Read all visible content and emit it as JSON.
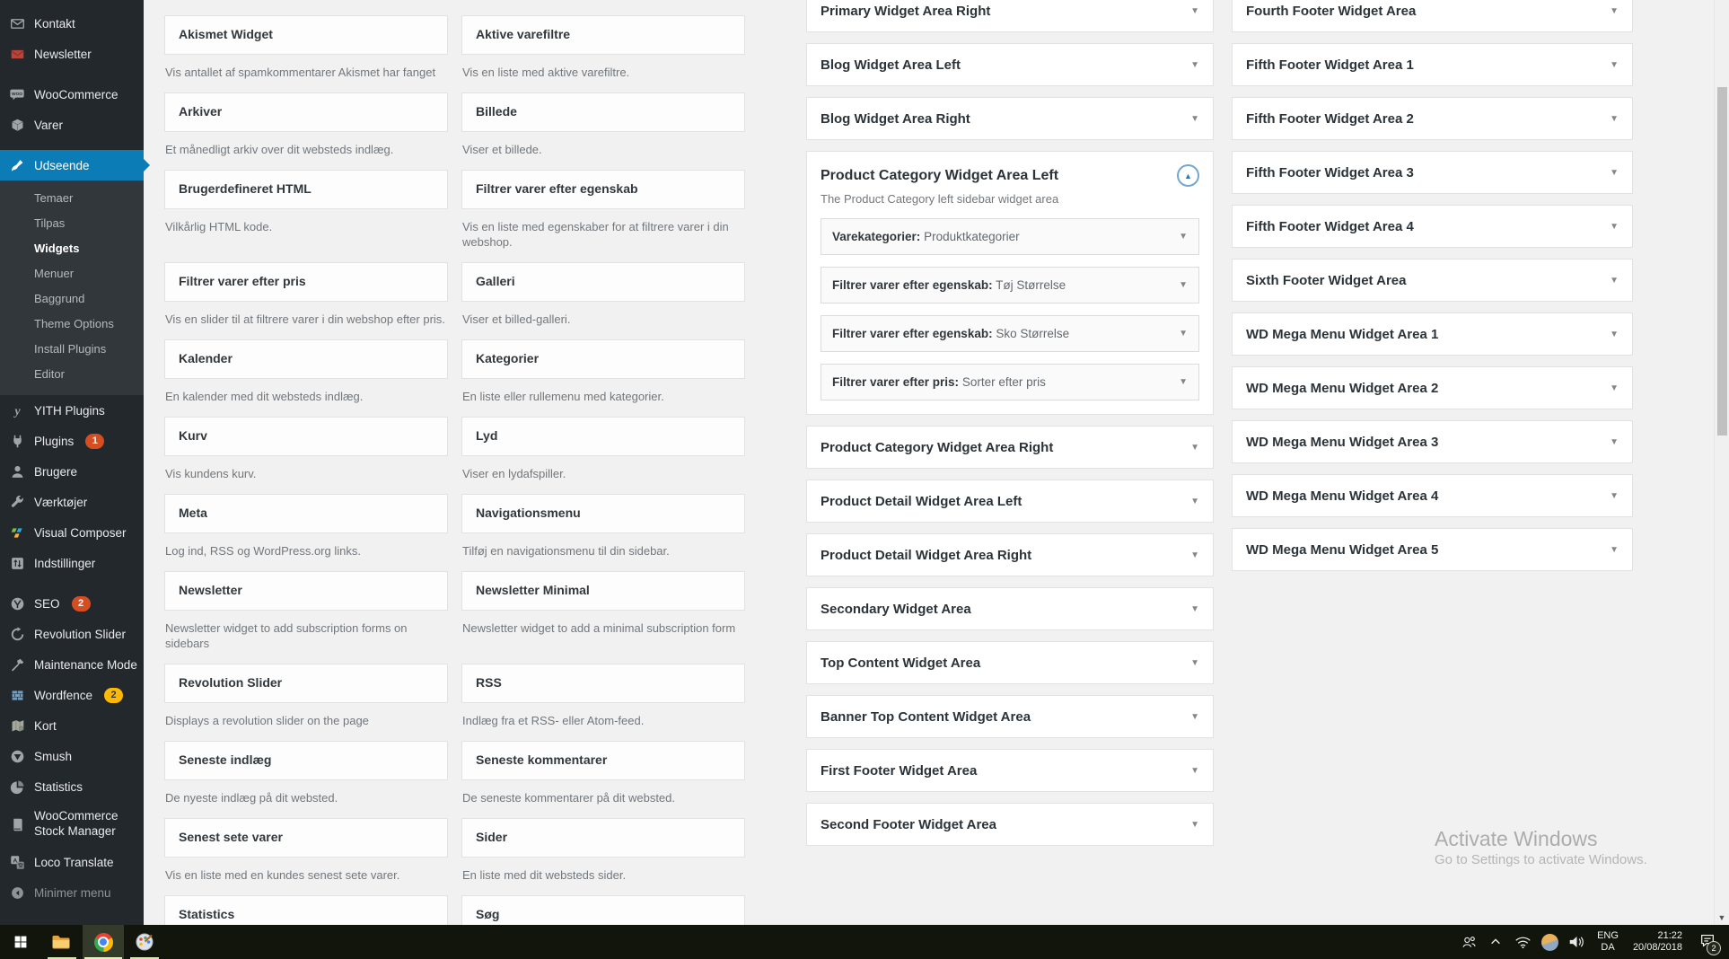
{
  "colors": {
    "accent_blue": "#0b7cb5",
    "badge_red": "#d54e21",
    "badge_yellow": "#ffb900",
    "sidebar_bg": "#23282d",
    "submenu_bg": "#32373c",
    "content_bg": "#f1f1f1"
  },
  "sidebar": {
    "items": [
      {
        "label": "Kontakt",
        "icon": "envelope-icon"
      },
      {
        "label": "Newsletter",
        "icon": "newsletter-envelope-icon"
      },
      {
        "sep": true
      },
      {
        "label": "WooCommerce",
        "icon": "woocommerce-icon"
      },
      {
        "label": "Varer",
        "icon": "product-box-icon"
      },
      {
        "sep": true
      },
      {
        "label": "Udseende",
        "icon": "paintbrush-icon",
        "active": true
      },
      {
        "submenu": [
          "Temaer",
          "Tilpas",
          "Widgets",
          "Menuer",
          "Baggrund",
          "Theme Options",
          "Install Plugins",
          "Editor"
        ],
        "current": "Widgets"
      },
      {
        "label": "YITH Plugins",
        "icon": "yith-icon"
      },
      {
        "label": "Plugins",
        "icon": "plug-icon",
        "badge": "1",
        "badge_style": "red"
      },
      {
        "label": "Brugere",
        "icon": "user-icon"
      },
      {
        "label": "Værktøjer",
        "icon": "wrench-icon"
      },
      {
        "label": "Visual Composer",
        "icon": "visual-composer-icon"
      },
      {
        "label": "Indstillinger",
        "icon": "settings-icon"
      },
      {
        "sep": true
      },
      {
        "label": "SEO",
        "icon": "yoast-seo-icon",
        "badge": "2",
        "badge_style": "red"
      },
      {
        "label": "Revolution Slider",
        "icon": "revolution-slider-icon"
      },
      {
        "label": "Maintenance Mode",
        "icon": "hammer-icon"
      },
      {
        "label": "Wordfence",
        "icon": "wordfence-icon",
        "badge": "2",
        "badge_style": "yellow"
      },
      {
        "label": "Kort",
        "icon": "map-icon"
      },
      {
        "label": "Smush",
        "icon": "smush-icon"
      },
      {
        "label": "Statistics",
        "icon": "pie-chart-icon"
      },
      {
        "label": "WooCommerce Stock Manager",
        "icon": "book-icon",
        "two_line": true
      },
      {
        "label": "Loco Translate",
        "icon": "translate-icon"
      },
      {
        "label": "Minimer menu",
        "icon": "collapse-icon",
        "muted": true
      }
    ]
  },
  "available_widgets": [
    {
      "title": "Akismet Widget",
      "desc": "Vis antallet af spamkommentarer Akismet har fanget"
    },
    {
      "title": "Aktive varefiltre",
      "desc": "Vis en liste med aktive varefiltre."
    },
    {
      "title": "Arkiver",
      "desc": "Et månedligt arkiv over dit websteds indlæg."
    },
    {
      "title": "Billede",
      "desc": "Viser et billede."
    },
    {
      "title": "Brugerdefineret HTML",
      "desc": "Vilkårlig HTML kode."
    },
    {
      "title": "Filtrer varer efter egenskab",
      "desc": "Vis en liste med egenskaber for at filtrere varer i din webshop."
    },
    {
      "title": "Filtrer varer efter pris",
      "desc": "Vis en slider til at filtrere varer i din webshop efter pris."
    },
    {
      "title": "Galleri",
      "desc": "Viser et billed-galleri."
    },
    {
      "title": "Kalender",
      "desc": "En kalender med dit websteds indlæg."
    },
    {
      "title": "Kategorier",
      "desc": "En liste eller rullemenu med kategorier."
    },
    {
      "title": "Kurv",
      "desc": "Vis kundens kurv."
    },
    {
      "title": "Lyd",
      "desc": "Viser en lydafspiller."
    },
    {
      "title": "Meta",
      "desc": "Log ind, RSS og WordPress.org links."
    },
    {
      "title": "Navigationsmenu",
      "desc": "Tilføj en navigationsmenu til din sidebar."
    },
    {
      "title": "Newsletter",
      "desc": "Newsletter widget to add subscription forms on sidebars"
    },
    {
      "title": "Newsletter Minimal",
      "desc": "Newsletter widget to add a minimal subscription form"
    },
    {
      "title": "Revolution Slider",
      "desc": "Displays a revolution slider on the page"
    },
    {
      "title": "RSS",
      "desc": "Indlæg fra et RSS- eller Atom-feed."
    },
    {
      "title": "Seneste indlæg",
      "desc": "De nyeste indlæg på dit websted."
    },
    {
      "title": "Seneste kommentarer",
      "desc": "De seneste kommentarer på dit websted."
    },
    {
      "title": "Senest sete varer",
      "desc": "Vis en liste med en kundes senest sete varer."
    },
    {
      "title": "Sider",
      "desc": "En liste med dit websteds sider."
    },
    {
      "title": "Statistics",
      "desc": ""
    },
    {
      "title": "Søg",
      "desc": ""
    }
  ],
  "widget_areas": {
    "middle": [
      {
        "title": "Primary Widget Area Right"
      },
      {
        "title": "Blog Widget Area Left"
      },
      {
        "title": "Blog Widget Area Right"
      },
      {
        "title": "Product Category Widget Area Left",
        "expanded": true,
        "description": "The Product Category left sidebar widget area",
        "widgets": [
          {
            "name": "Varekategorier:",
            "title": "Produktkategorier"
          },
          {
            "name": "Filtrer varer efter egenskab:",
            "title": "Tøj Størrelse"
          },
          {
            "name": "Filtrer varer efter egenskab:",
            "title": "Sko Størrelse"
          },
          {
            "name": "Filtrer varer efter pris:",
            "title": "Sorter efter pris"
          }
        ]
      },
      {
        "title": "Product Category Widget Area Right"
      },
      {
        "title": "Product Detail Widget Area Left"
      },
      {
        "title": "Product Detail Widget Area Right"
      },
      {
        "title": "Secondary Widget Area"
      },
      {
        "title": "Top Content Widget Area"
      },
      {
        "title": "Banner Top Content Widget Area"
      },
      {
        "title": "First Footer Widget Area"
      },
      {
        "title": "Second Footer Widget Area"
      }
    ],
    "right": [
      {
        "title": "Fourth Footer Widget Area"
      },
      {
        "title": "Fifth Footer Widget Area 1"
      },
      {
        "title": "Fifth Footer Widget Area 2"
      },
      {
        "title": "Fifth Footer Widget Area 3"
      },
      {
        "title": "Fifth Footer Widget Area 4"
      },
      {
        "title": "Sixth Footer Widget Area"
      },
      {
        "title": "WD Mega Menu Widget Area 1"
      },
      {
        "title": "WD Mega Menu Widget Area 2"
      },
      {
        "title": "WD Mega Menu Widget Area 3"
      },
      {
        "title": "WD Mega Menu Widget Area 4"
      },
      {
        "title": "WD Mega Menu Widget Area 5"
      }
    ]
  },
  "watermark": {
    "line1": "Activate Windows",
    "line2": "Go to Settings to activate Windows."
  },
  "taskbar": {
    "pinned": [
      {
        "icon": "windows-start-icon"
      },
      {
        "icon": "file-explorer-icon",
        "running": true
      },
      {
        "icon": "chrome-icon",
        "running": true,
        "active": true
      },
      {
        "icon": "paint-icon",
        "running": true
      }
    ],
    "tray_icons": [
      "people-icon",
      "chevron-up-icon",
      "wifi-icon",
      "color-profile-icon",
      "speaker-icon"
    ],
    "language_top": "ENG",
    "language_bottom": "DA",
    "time": "21:22",
    "date": "20/08/2018",
    "notification_count": "2"
  }
}
